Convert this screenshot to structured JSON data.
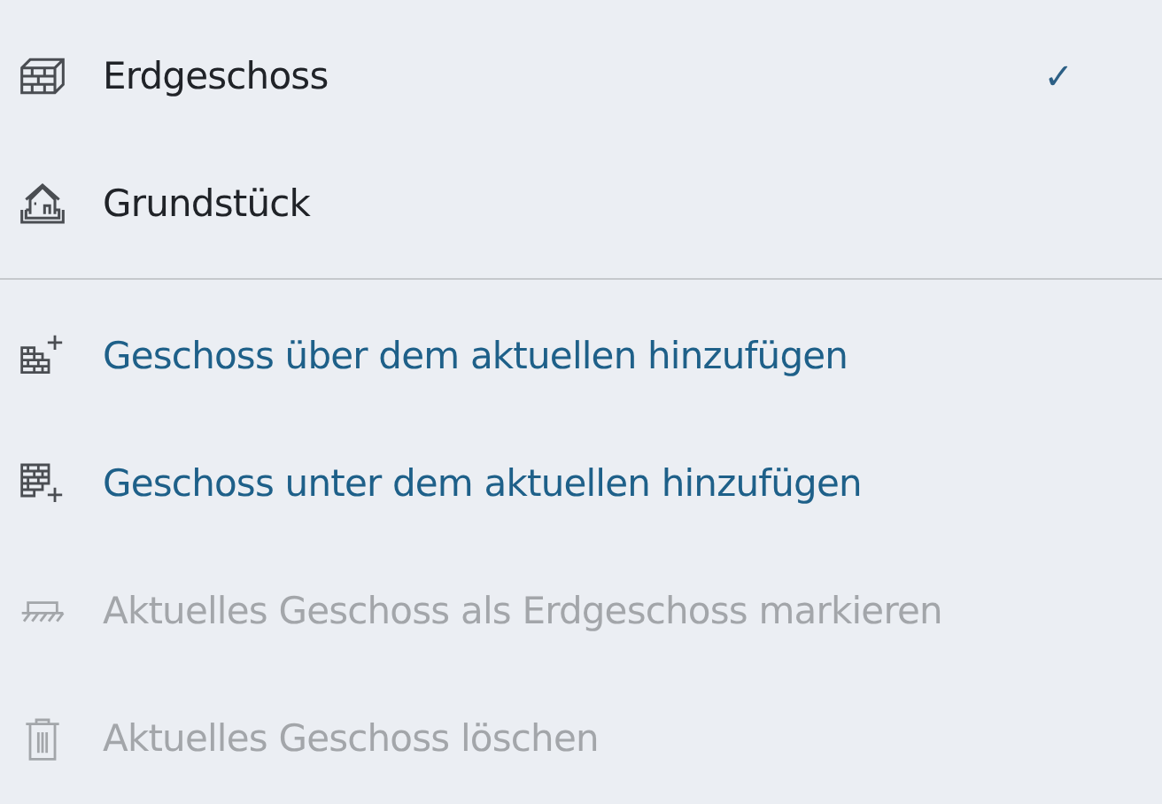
{
  "floors": [
    {
      "label": "Erdgeschoss",
      "checked": true
    },
    {
      "label": "Grundstück",
      "checked": false
    }
  ],
  "check_mark": "✓",
  "actions": [
    {
      "label": "Geschoss über dem aktuellen hinzufügen",
      "disabled": false
    },
    {
      "label": "Geschoss unter dem aktuellen hinzufügen",
      "disabled": false
    },
    {
      "label": "Aktuelles Geschoss als Erdgeschoss markieren",
      "disabled": true
    },
    {
      "label": "Aktuelles Geschoss löschen",
      "disabled": true
    }
  ]
}
